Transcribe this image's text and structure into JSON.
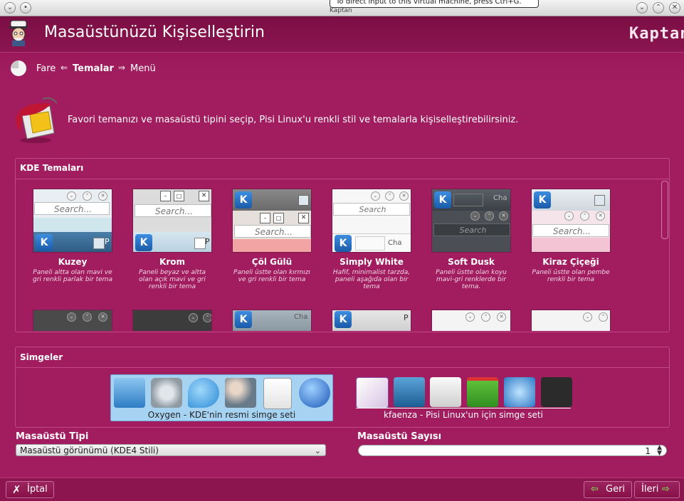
{
  "window": {
    "tooltip_line1": "To direct input to this virtual machine, press Ctrl+G.",
    "tooltip_line2": "Kaptan",
    "buttons": {
      "minimize": "⌄",
      "maximize": "⌃",
      "close": "✕"
    }
  },
  "header": {
    "title": "Masaüstünüzü Kişiselleştirin",
    "brand": "Kaptan"
  },
  "breadcrumb": {
    "prev": "Fare",
    "current": "Temalar",
    "next": "Menü",
    "arrow_left": "⇐",
    "arrow_right": "⇒"
  },
  "intro": {
    "text": "Favori temanızı ve masaüstü tipini seçip, Pisi Linux'u renkli stil ve temalarla kişiselleştirebilirsiniz."
  },
  "themes_panel": {
    "title": "KDE Temaları",
    "search_placeholder": "Search...",
    "search_placeholder_short": "Search",
    "taskbar_text_p": "P",
    "taskbar_text_cha": "Cha",
    "k_logo": "K",
    "themes": [
      {
        "name": "Kuzey",
        "desc": "Paneli altta olan mavi ve gri renkli parlak bir tema"
      },
      {
        "name": "Krom",
        "desc": "Paneli beyaz ve altta olan açık mavi ve gri renkli bir tema"
      },
      {
        "name": "Çöl Gülü",
        "desc": "Paneli üstte olan kırmızı ve gri renkli bir tema"
      },
      {
        "name": "Simply White",
        "desc": "Hafif, minimalist tarzda, paneli aşağıda olan bir tema"
      },
      {
        "name": "Soft Dusk",
        "desc": "Paneli üstte olan koyu mavi-gri renklerde bir tema."
      },
      {
        "name": "Kiraz Çiçeği",
        "desc": "Paneli üstte olan pembe renkli bir tema"
      }
    ]
  },
  "icons_panel": {
    "title": "Simgeler",
    "sets": [
      {
        "label": "Oxygen - KDE'nin resmi simge seti",
        "selected": true
      },
      {
        "label": "kfaenza - Pisi Linux'un için simge seti",
        "selected": false
      }
    ]
  },
  "desktop_type": {
    "label": "Masaüstü Tipi",
    "value": "Masaüstü görünümü (KDE4 Stili)"
  },
  "desktop_count": {
    "label": "Masaüstü Sayısı",
    "value": "1"
  },
  "footer": {
    "cancel": "İptal",
    "back": "Geri",
    "next": "İleri"
  },
  "colors": {
    "background": "#a21d60",
    "header": "#8c1550",
    "accent": "#c04a86"
  }
}
